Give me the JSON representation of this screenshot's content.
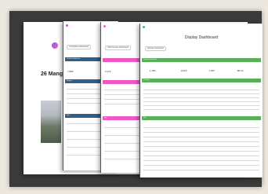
{
  "cover": {
    "title": "26 Mangar",
    "brand": "TDESK.CO.NZ"
  },
  "slide2": {
    "pill": "Compliance Dashboard",
    "band_top": "General Statistics",
    "kpi_value": "7,582",
    "band_mid": "Region",
    "band_low": "Site"
  },
  "slide3": {
    "pill": "Gift Purchase Dashboard",
    "kpi_value": "2,174",
    "band_low": "Site"
  },
  "slide4": {
    "pill": "Website Dashboard",
    "heading": "Display Dashboard",
    "band_top": "General Statistics",
    "kpis": [
      "1,784",
      "114 K",
      "1.50*",
      "80.14"
    ],
    "band_mid": "Country",
    "band_low": "Site"
  },
  "colors": {
    "blue_band": "#2f5f8a",
    "pink_band": "#ef57c6",
    "green_band": "#5ab05a"
  }
}
